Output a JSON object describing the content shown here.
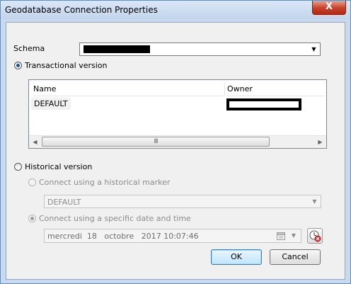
{
  "window": {
    "title": "Geodatabase Connection Properties",
    "close_label": "X"
  },
  "schema": {
    "label": "Schema",
    "value": ""
  },
  "transactional": {
    "label": "Transactional version",
    "selected": true,
    "columns": [
      "Name",
      "Owner"
    ],
    "rows": [
      {
        "name": "DEFAULT",
        "owner": ""
      }
    ],
    "scroll_grip": "III"
  },
  "historical": {
    "label": "Historical version",
    "selected": false,
    "marker_option": {
      "label": "Connect using a historical marker",
      "selected": false
    },
    "marker_value": "DEFAULT",
    "date_option": {
      "label": "Connect using a specific date and time",
      "selected": true
    },
    "date_value": "mercredi  18   octobre   2017 10:07:46"
  },
  "buttons": {
    "ok": "OK",
    "cancel": "Cancel"
  },
  "icons": {
    "dropdown": "chevron-down-icon",
    "scroll_left": "arrow-left-icon",
    "scroll_right": "arrow-right-icon",
    "calendar": "calendar-icon",
    "clock": "clock-icon"
  }
}
